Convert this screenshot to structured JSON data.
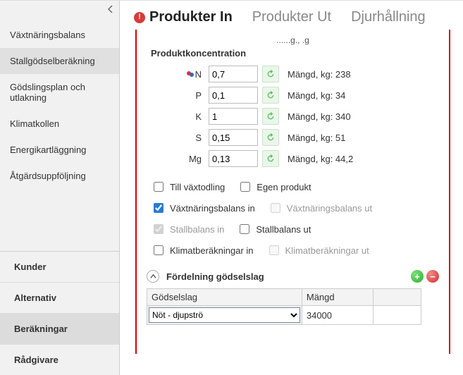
{
  "sidebar": {
    "top": [
      {
        "label": "Växtnäringsbalans",
        "selected": false
      },
      {
        "label": "Stallgödselberäkning",
        "selected": true
      },
      {
        "label": "Gödslingsplan och utlakning",
        "selected": false
      },
      {
        "label": "Klimatkollen",
        "selected": false
      },
      {
        "label": "Energikartläggning",
        "selected": false
      },
      {
        "label": "Åtgärdsuppföljning",
        "selected": false
      }
    ],
    "bottom": [
      {
        "label": "Kunder",
        "active": false
      },
      {
        "label": "Alternativ",
        "active": false
      },
      {
        "label": "Beräkningar",
        "active": true
      },
      {
        "label": "Rådgivare",
        "active": false
      }
    ]
  },
  "tabs": [
    {
      "label": "Produkter In",
      "active": true,
      "error": true
    },
    {
      "label": "Produkter Ut",
      "active": false,
      "error": false
    },
    {
      "label": "Djurhållning",
      "active": false,
      "error": false
    }
  ],
  "truncated_label": "......g., .g",
  "section_title": "Produktkoncentration",
  "nutrients": [
    {
      "key": "N",
      "value": "0,7",
      "amount_label": "Mängd, kg: 238",
      "pinned": true
    },
    {
      "key": "P",
      "value": "0,1",
      "amount_label": "Mängd, kg: 34",
      "pinned": false
    },
    {
      "key": "K",
      "value": "1",
      "amount_label": "Mängd, kg: 340",
      "pinned": false
    },
    {
      "key": "S",
      "value": "0,15",
      "amount_label": "Mängd, kg: 51",
      "pinned": false
    },
    {
      "key": "Mg",
      "value": "0,13",
      "amount_label": "Mängd, kg: 44,2",
      "pinned": false
    }
  ],
  "checks": {
    "till_vaxtodling": {
      "label": "Till växtodling",
      "checked": false,
      "disabled": false
    },
    "egen_produkt": {
      "label": "Egen produkt",
      "checked": false,
      "disabled": false
    },
    "vaxt_in": {
      "label": "Växtnäringsbalans in",
      "checked": true,
      "disabled": false
    },
    "vaxt_ut": {
      "label": "Växtnäringsbalans ut",
      "checked": false,
      "disabled": true
    },
    "stall_in": {
      "label": "Stallbalans in",
      "checked": true,
      "disabled": true
    },
    "stall_ut": {
      "label": "Stallbalans ut",
      "checked": false,
      "disabled": false
    },
    "klimat_in": {
      "label": "Klimatberäkningar in",
      "checked": false,
      "disabled": false
    },
    "klimat_ut": {
      "label": "Klimatberäkningar ut",
      "checked": false,
      "disabled": true
    }
  },
  "expander": {
    "title": "Fördelning gödselslag"
  },
  "table": {
    "headers": [
      "Gödselslag",
      "Mängd"
    ],
    "row": {
      "type": "Nöt - djupströ",
      "amount": "34000"
    }
  }
}
